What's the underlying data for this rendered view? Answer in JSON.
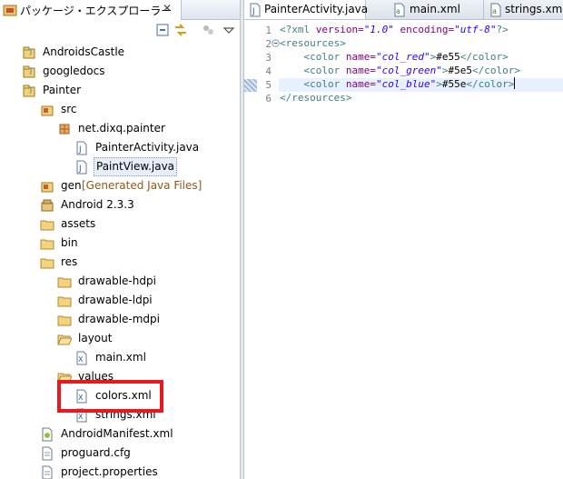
{
  "explorer": {
    "title": "パッケージ・エクスプローラー",
    "close": "✕",
    "items": [
      {
        "label": "AndroidsCastle",
        "icon": "android-project-icon"
      },
      {
        "label": "googledocs",
        "icon": "android-project-icon"
      },
      {
        "label": "Painter",
        "icon": "android-project-icon"
      },
      {
        "label": "src",
        "icon": "source-folder-icon"
      },
      {
        "label": "net.dixq.painter",
        "icon": "package-icon"
      },
      {
        "label": "PainterActivity.java",
        "icon": "java-file-icon"
      },
      {
        "label": "PaintView.java",
        "icon": "java-file-icon"
      },
      {
        "label": "gen",
        "decoration": "[Generated Java Files]",
        "icon": "source-folder-icon"
      },
      {
        "label": "Android 2.3.3",
        "icon": "library-icon"
      },
      {
        "label": "assets",
        "icon": "folder-icon"
      },
      {
        "label": "bin",
        "icon": "folder-icon"
      },
      {
        "label": "res",
        "icon": "folder-icon"
      },
      {
        "label": "drawable-hdpi",
        "icon": "folder-icon"
      },
      {
        "label": "drawable-ldpi",
        "icon": "folder-icon"
      },
      {
        "label": "drawable-mdpi",
        "icon": "folder-icon"
      },
      {
        "label": "layout",
        "icon": "folder-open-icon"
      },
      {
        "label": "main.xml",
        "icon": "xml-file-icon"
      },
      {
        "label": "values",
        "icon": "folder-open-icon"
      },
      {
        "label": "colors.xml",
        "icon": "xml-file-icon"
      },
      {
        "label": "strings.xml",
        "icon": "xml-file-icon"
      },
      {
        "label": "AndroidManifest.xml",
        "icon": "android-manifest-icon"
      },
      {
        "label": "proguard.cfg",
        "icon": "file-icon"
      },
      {
        "label": "project.properties",
        "icon": "file-icon"
      }
    ]
  },
  "editor": {
    "tabs": [
      {
        "label": "PainterActivity.java",
        "icon": "java-file-icon"
      },
      {
        "label": "main.xml",
        "icon": "xml-file-icon"
      },
      {
        "label": "strings.xml",
        "icon": "xml-file-icon"
      }
    ],
    "line_numbers": [
      "1",
      "2",
      "3",
      "4",
      "5",
      "6"
    ],
    "code": {
      "l1_open": "<?xml",
      "l1_a1": " version=",
      "l1_v1": "\"1.0\"",
      "l1_a2": " encoding=",
      "l1_v2": "\"utf-8\"",
      "l1_close": "?>",
      "l2": "<resources>",
      "l3_open": "<color",
      "l3_attr": " name=",
      "l3_val": "\"col_red\"",
      "l3_gt": ">",
      "l3_text": "#e55",
      "l3_end": "</color>",
      "l4_open": "<color",
      "l4_attr": " name=",
      "l4_val": "\"col_green\"",
      "l4_gt": ">",
      "l4_text": "#5e5",
      "l4_end": "</color>",
      "l5_open": "<color",
      "l5_attr": " name=",
      "l5_val": "\"col_blue\"",
      "l5_gt": ">",
      "l5_text": "#55e",
      "l5_end": "</color>",
      "l6": "</resources>"
    }
  },
  "colors": {
    "highlight": "#e8191e",
    "xml_tag": "#3f7f7f",
    "xml_attr": "#7f007f",
    "xml_value": "#2a00ff"
  }
}
